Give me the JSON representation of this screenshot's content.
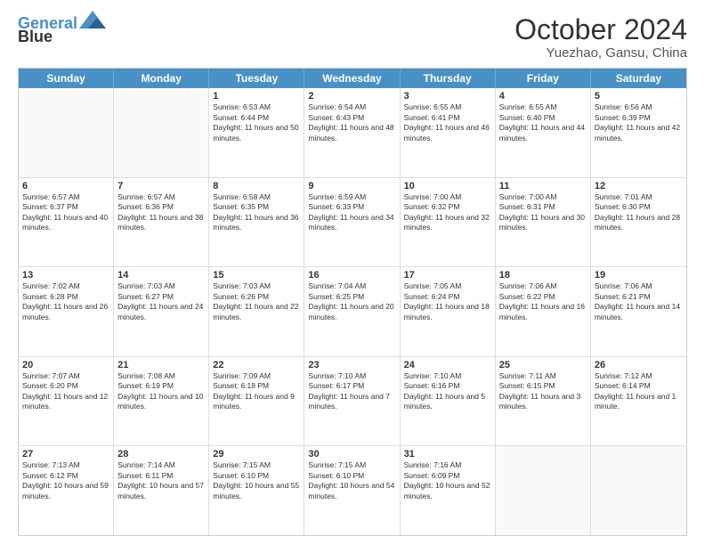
{
  "logo": {
    "line1": "General",
    "line2": "Blue"
  },
  "title": "October 2024",
  "subtitle": "Yuezhao, Gansu, China",
  "weekdays": [
    "Sunday",
    "Monday",
    "Tuesday",
    "Wednesday",
    "Thursday",
    "Friday",
    "Saturday"
  ],
  "weeks": [
    [
      {
        "day": "",
        "info": ""
      },
      {
        "day": "",
        "info": ""
      },
      {
        "day": "1",
        "info": "Sunrise: 6:53 AM\nSunset: 6:44 PM\nDaylight: 11 hours and 50 minutes."
      },
      {
        "day": "2",
        "info": "Sunrise: 6:54 AM\nSunset: 6:43 PM\nDaylight: 11 hours and 48 minutes."
      },
      {
        "day": "3",
        "info": "Sunrise: 6:55 AM\nSunset: 6:41 PM\nDaylight: 11 hours and 46 minutes."
      },
      {
        "day": "4",
        "info": "Sunrise: 6:55 AM\nSunset: 6:40 PM\nDaylight: 11 hours and 44 minutes."
      },
      {
        "day": "5",
        "info": "Sunrise: 6:56 AM\nSunset: 6:39 PM\nDaylight: 11 hours and 42 minutes."
      }
    ],
    [
      {
        "day": "6",
        "info": "Sunrise: 6:57 AM\nSunset: 6:37 PM\nDaylight: 11 hours and 40 minutes."
      },
      {
        "day": "7",
        "info": "Sunrise: 6:57 AM\nSunset: 6:36 PM\nDaylight: 11 hours and 38 minutes."
      },
      {
        "day": "8",
        "info": "Sunrise: 6:58 AM\nSunset: 6:35 PM\nDaylight: 11 hours and 36 minutes."
      },
      {
        "day": "9",
        "info": "Sunrise: 6:59 AM\nSunset: 6:33 PM\nDaylight: 11 hours and 34 minutes."
      },
      {
        "day": "10",
        "info": "Sunrise: 7:00 AM\nSunset: 6:32 PM\nDaylight: 11 hours and 32 minutes."
      },
      {
        "day": "11",
        "info": "Sunrise: 7:00 AM\nSunset: 6:31 PM\nDaylight: 11 hours and 30 minutes."
      },
      {
        "day": "12",
        "info": "Sunrise: 7:01 AM\nSunset: 6:30 PM\nDaylight: 11 hours and 28 minutes."
      }
    ],
    [
      {
        "day": "13",
        "info": "Sunrise: 7:02 AM\nSunset: 6:28 PM\nDaylight: 11 hours and 26 minutes."
      },
      {
        "day": "14",
        "info": "Sunrise: 7:03 AM\nSunset: 6:27 PM\nDaylight: 11 hours and 24 minutes."
      },
      {
        "day": "15",
        "info": "Sunrise: 7:03 AM\nSunset: 6:26 PM\nDaylight: 11 hours and 22 minutes."
      },
      {
        "day": "16",
        "info": "Sunrise: 7:04 AM\nSunset: 6:25 PM\nDaylight: 11 hours and 20 minutes."
      },
      {
        "day": "17",
        "info": "Sunrise: 7:05 AM\nSunset: 6:24 PM\nDaylight: 11 hours and 18 minutes."
      },
      {
        "day": "18",
        "info": "Sunrise: 7:06 AM\nSunset: 6:22 PM\nDaylight: 11 hours and 16 minutes."
      },
      {
        "day": "19",
        "info": "Sunrise: 7:06 AM\nSunset: 6:21 PM\nDaylight: 11 hours and 14 minutes."
      }
    ],
    [
      {
        "day": "20",
        "info": "Sunrise: 7:07 AM\nSunset: 6:20 PM\nDaylight: 11 hours and 12 minutes."
      },
      {
        "day": "21",
        "info": "Sunrise: 7:08 AM\nSunset: 6:19 PM\nDaylight: 11 hours and 10 minutes."
      },
      {
        "day": "22",
        "info": "Sunrise: 7:09 AM\nSunset: 6:18 PM\nDaylight: 11 hours and 9 minutes."
      },
      {
        "day": "23",
        "info": "Sunrise: 7:10 AM\nSunset: 6:17 PM\nDaylight: 11 hours and 7 minutes."
      },
      {
        "day": "24",
        "info": "Sunrise: 7:10 AM\nSunset: 6:16 PM\nDaylight: 11 hours and 5 minutes."
      },
      {
        "day": "25",
        "info": "Sunrise: 7:11 AM\nSunset: 6:15 PM\nDaylight: 11 hours and 3 minutes."
      },
      {
        "day": "26",
        "info": "Sunrise: 7:12 AM\nSunset: 6:14 PM\nDaylight: 11 hours and 1 minute."
      }
    ],
    [
      {
        "day": "27",
        "info": "Sunrise: 7:13 AM\nSunset: 6:12 PM\nDaylight: 10 hours and 59 minutes."
      },
      {
        "day": "28",
        "info": "Sunrise: 7:14 AM\nSunset: 6:11 PM\nDaylight: 10 hours and 57 minutes."
      },
      {
        "day": "29",
        "info": "Sunrise: 7:15 AM\nSunset: 6:10 PM\nDaylight: 10 hours and 55 minutes."
      },
      {
        "day": "30",
        "info": "Sunrise: 7:15 AM\nSunset: 6:10 PM\nDaylight: 10 hours and 54 minutes."
      },
      {
        "day": "31",
        "info": "Sunrise: 7:16 AM\nSunset: 6:09 PM\nDaylight: 10 hours and 52 minutes."
      },
      {
        "day": "",
        "info": ""
      },
      {
        "day": "",
        "info": ""
      }
    ]
  ]
}
